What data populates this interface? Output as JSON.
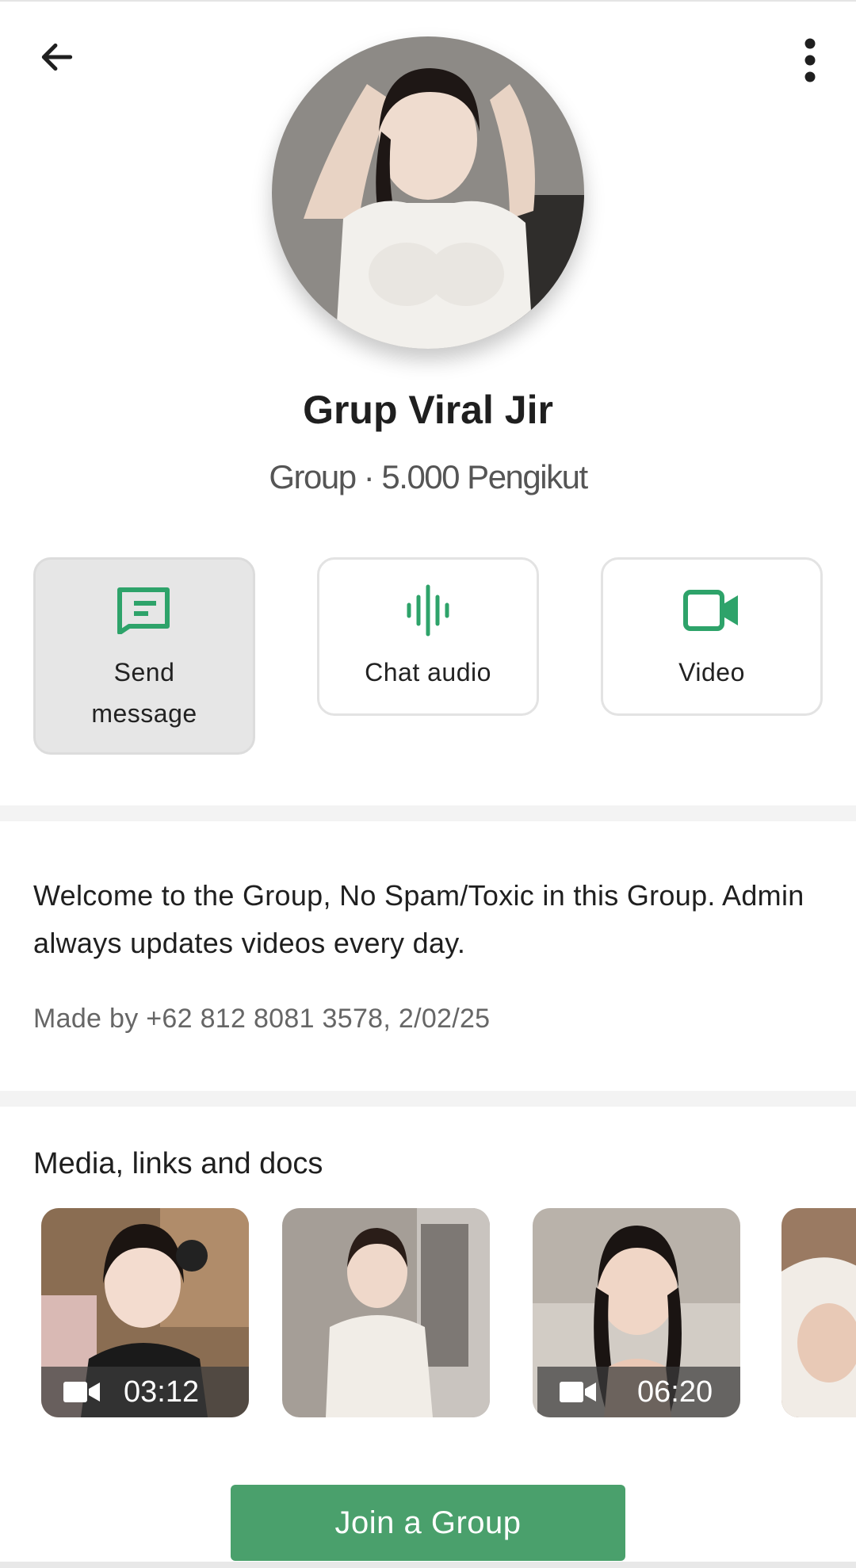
{
  "header": {
    "back_icon": "arrow-left-icon",
    "menu_icon": "more-vertical-icon"
  },
  "profile": {
    "name": "Grup Viral Jir",
    "meta": "Group · 5.000 Pengikut"
  },
  "actions": [
    {
      "label": "Send message",
      "icon": "message-icon"
    },
    {
      "label": "Chat audio",
      "icon": "audio-wave-icon"
    },
    {
      "label": "Video",
      "icon": "video-camera-icon"
    }
  ],
  "accent_color": "#2ea36a",
  "about": {
    "description": "Welcome to the Group, No Spam/Toxic in this Group. Admin always updates videos every day.",
    "created": "Made by +62 812 8081 3578, 2/02/25"
  },
  "media": {
    "title": "Media, links and docs",
    "items": [
      {
        "type": "video",
        "duration": "03:12"
      },
      {
        "type": "image",
        "duration": ""
      },
      {
        "type": "video",
        "duration": "06:20"
      },
      {
        "type": "image",
        "duration": ""
      }
    ]
  },
  "join_button": {
    "label": "Join a Group",
    "color": "#4aa06c"
  }
}
